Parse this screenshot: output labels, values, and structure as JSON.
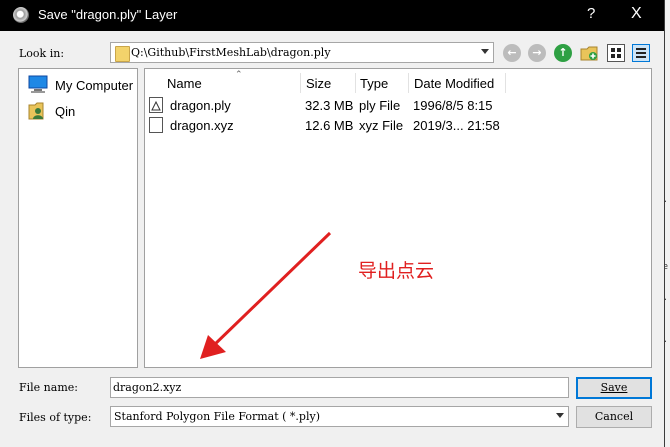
{
  "dialog": {
    "title": "Save \"dragon.ply\" Layer",
    "help": "?",
    "close": "X"
  },
  "look_in": {
    "label": "Look in:",
    "path": "Q:\\Github\\FirstMeshLab\\dragon.ply"
  },
  "toolbar": {
    "icons": [
      "back-icon",
      "forward-icon",
      "up-icon",
      "new-folder-icon",
      "list-view-icon",
      "detail-view-icon"
    ]
  },
  "sidebar": {
    "items": [
      {
        "label": "My Computer",
        "icon": "computer-icon"
      },
      {
        "label": "Qin",
        "icon": "user-folder-icon"
      }
    ]
  },
  "file_list": {
    "columns": [
      "Name",
      "Size",
      "Type",
      "Date Modified"
    ],
    "rows": [
      {
        "name": "dragon.ply",
        "size": "32.3 MB",
        "type": "ply File",
        "date": "1996/8/5 8:15",
        "icon": "ply-file-icon"
      },
      {
        "name": "dragon.xyz",
        "size": "12.6 MB",
        "type": "xyz File",
        "date": "2019/3... 21:58",
        "icon": "text-file-icon"
      }
    ]
  },
  "annotation": {
    "text": "导出点云",
    "color": "#e02020"
  },
  "file_name": {
    "label": "File name:",
    "value": "dragon2.xyz"
  },
  "file_type": {
    "label": "Files of type:",
    "value": "Stanford Polygon File Format ( *.ply)"
  },
  "buttons": {
    "save": "Save",
    "cancel": "Cancel"
  },
  "colors": {
    "titlebar": "#000000",
    "dialog_bg": "#f0f0f0",
    "accent": "#0078d7"
  }
}
